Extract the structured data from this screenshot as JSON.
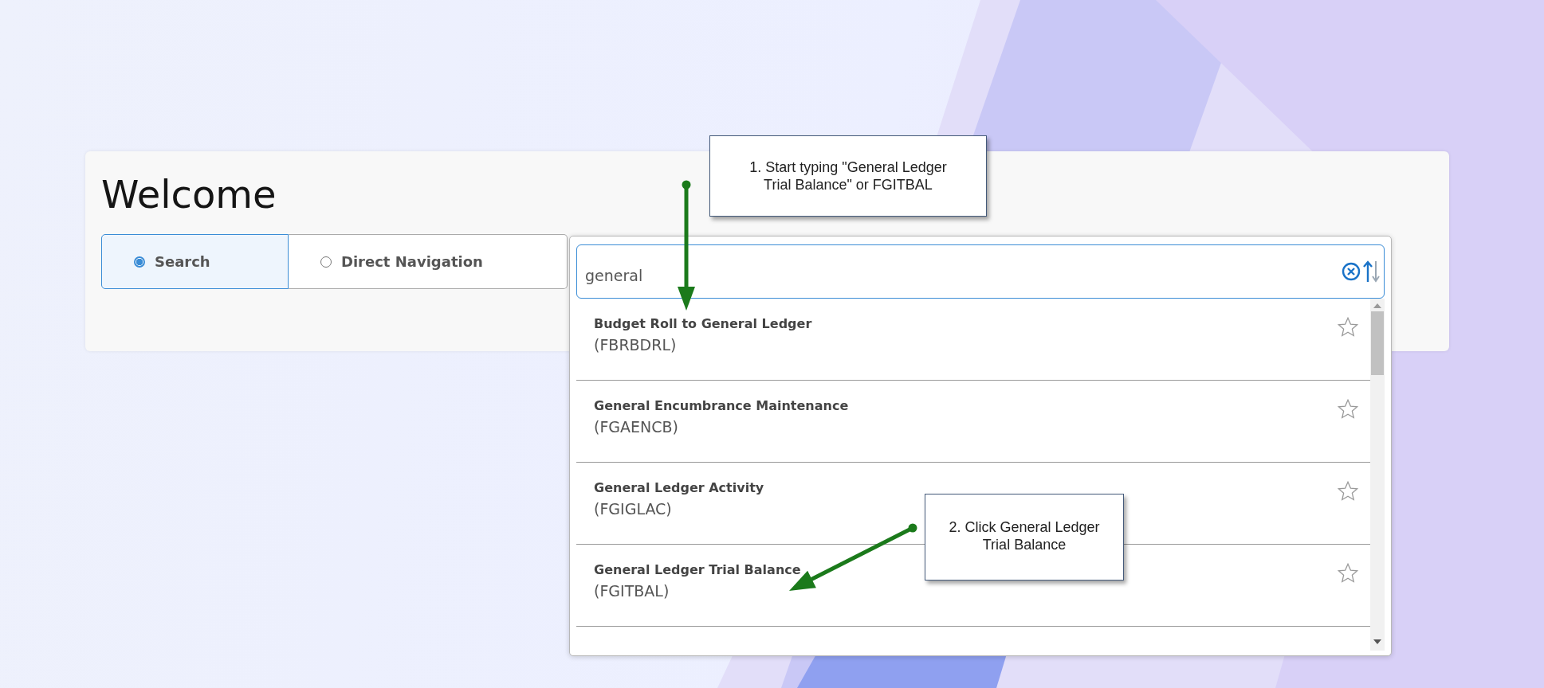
{
  "heading": "Welcome",
  "modes": [
    {
      "label": "Search",
      "selected": true
    },
    {
      "label": "Direct Navigation",
      "selected": false
    }
  ],
  "search": {
    "value": "general"
  },
  "results": [
    {
      "title": "Budget Roll to General Ledger",
      "code": "(FBRBDRL)",
      "favorite": false
    },
    {
      "title": "General Encumbrance Maintenance",
      "code": "(FGAENCB)",
      "favorite": false
    },
    {
      "title": "General Ledger Activity",
      "code": "(FGIGLAC)",
      "favorite": false
    },
    {
      "title": "General Ledger Trial Balance",
      "code": "(FGITBAL)",
      "favorite": false
    }
  ],
  "callouts": [
    {
      "text": "1. Start typing \"General Ledger Trial Balance\" or FGITBAL"
    },
    {
      "text": "2. Click General Ledger Trial Balance"
    }
  ]
}
